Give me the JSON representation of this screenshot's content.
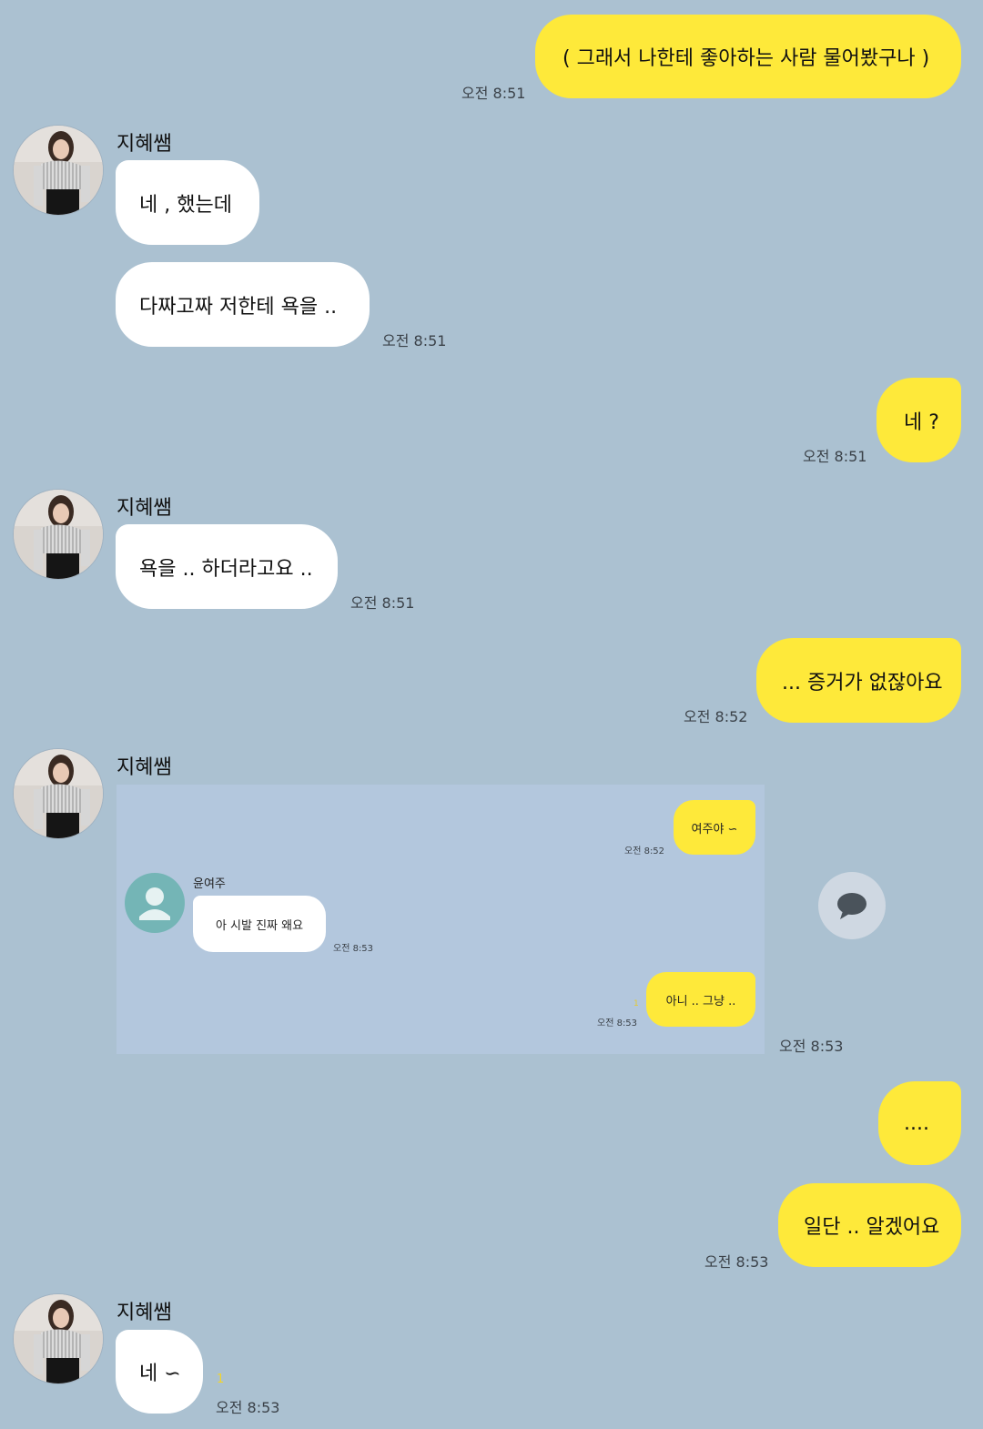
{
  "contact_name": "지혜쌤",
  "messages": [
    {
      "text": "( 그래서 나한테 좋아하는 사람 물어봤구나 )",
      "time": "오전 8:51"
    },
    {
      "text": "네 , 했는데"
    },
    {
      "text": "다짜고짜 저한테 욕을 ..",
      "time": "오전 8:51"
    },
    {
      "text": "네 ?",
      "time": "오전 8:51"
    },
    {
      "text": "욕을 .. 하더라고요 ..",
      "time": "오전 8:51"
    },
    {
      "text": "... 증거가 없잖아요",
      "time": "오전 8:52"
    },
    {
      "time": "오전 8:53"
    },
    {
      "text": "...."
    },
    {
      "text": "일단 .. 알겠어요",
      "time": "오전 8:53"
    },
    {
      "text": "네 ∽",
      "time": "오전 8:53",
      "unread": "1"
    }
  ],
  "embedded_chat": {
    "contact_name": "윤여주",
    "messages": [
      {
        "text": "여주야 ∽",
        "time": "오전 8:52"
      },
      {
        "text": "아 시발 진짜 왜요",
        "time": "오전 8:53"
      },
      {
        "text": "아니 .. 그냥 ..",
        "time": "오전 8:53",
        "unread": "1"
      }
    ]
  },
  "colors": {
    "background": "#abc1d1",
    "my_bubble": "#fee93a",
    "their_bubble": "#ffffff",
    "embed_background": "#b3c7dd",
    "default_avatar": "#74b5b6"
  },
  "icons": [
    "default-profile-icon",
    "chat-bubble-icon"
  ]
}
